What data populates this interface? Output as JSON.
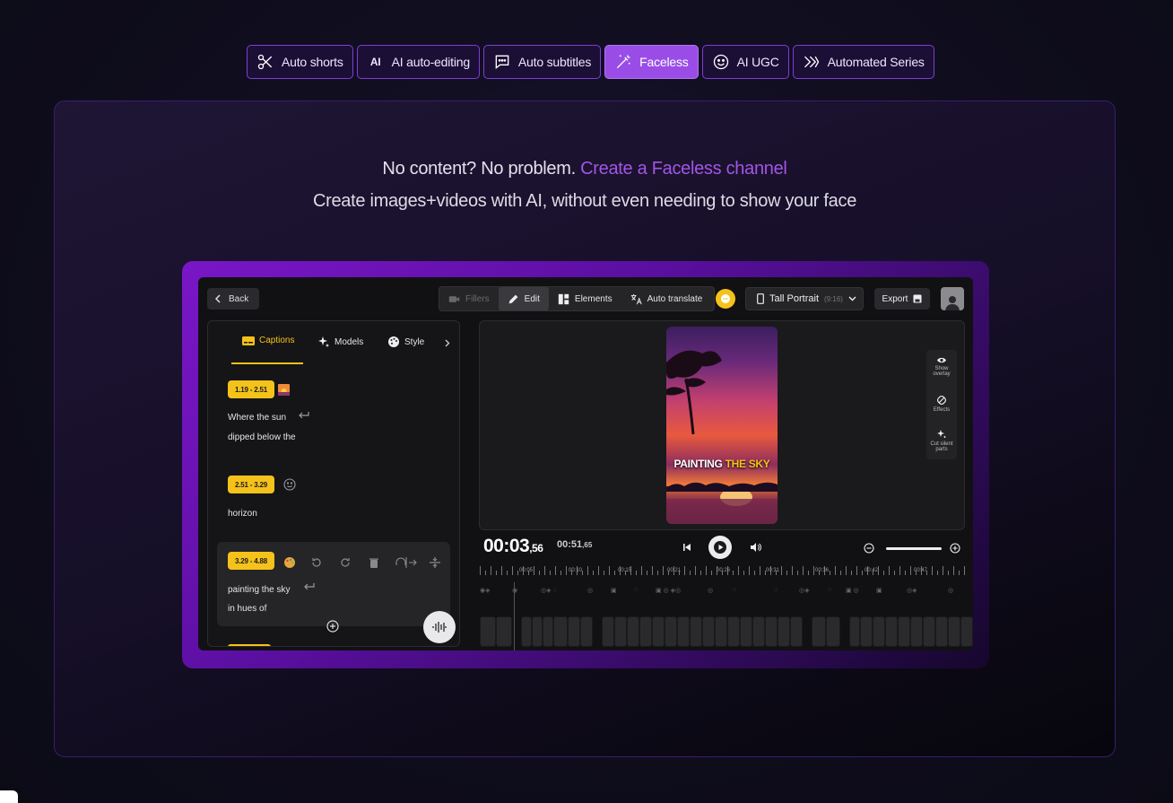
{
  "feature_tabs": [
    {
      "label": "Auto shorts",
      "icon": "scissors-icon",
      "active": false
    },
    {
      "label": "AI auto-editing",
      "icon": "ai-icon",
      "active": false
    },
    {
      "label": "Auto subtitles",
      "icon": "speech-bubble-icon",
      "active": false
    },
    {
      "label": "Faceless",
      "icon": "magic-wand-icon",
      "active": true
    },
    {
      "label": "AI UGC",
      "icon": "face-icon",
      "active": false
    },
    {
      "label": "Automated Series",
      "icon": "chevrons-icon",
      "active": false
    }
  ],
  "ai_glyph": "AI",
  "headline": {
    "lead": "No content? No problem.",
    "accent": "Create a Faceless channel"
  },
  "subline": "Create images+videos with AI, without even needing to show your face",
  "colors": {
    "accent": "#a455e6",
    "caption_yellow": "#f5c21b",
    "active_tab": "#9a4de6"
  },
  "editor": {
    "back_label": "Back",
    "modes": [
      {
        "label": "Fillers",
        "state": "disabled"
      },
      {
        "label": "Edit",
        "state": "active"
      },
      {
        "label": "Elements",
        "state": "normal"
      },
      {
        "label": "Auto translate",
        "state": "normal"
      }
    ],
    "format": {
      "label": "Tall Portrait",
      "ratio": "(9:16)"
    },
    "export_label": "Export",
    "caption_tabs": [
      "Captions",
      "Models",
      "Style"
    ],
    "captions": [
      {
        "time": "1.19 - 2.51",
        "lines": [
          "Where the sun",
          "dipped below the"
        ]
      },
      {
        "time": "2.51 - 3.29",
        "lines": [
          "horizon"
        ]
      },
      {
        "time": "3.29 - 4.88",
        "lines": [
          "painting the sky",
          "in hues of"
        ]
      }
    ],
    "preview": {
      "title_white": "PAINTING",
      "title_yellow": "THE SKY"
    },
    "side_tools": [
      {
        "label": "Show overlay",
        "icon": "eye-icon"
      },
      {
        "label": "Effects",
        "icon": "effects-icon"
      },
      {
        "label": "Cut silent parts",
        "icon": "sparkles-icon"
      }
    ],
    "timecode": {
      "main": "00:03",
      "frac": ",56"
    },
    "duration": {
      "main": "00:51",
      "frac": ",65"
    },
    "ruler_labels": [
      "00:05",
      "00:10",
      "00:15",
      "00:21",
      "00:26",
      "00:31",
      "00:36",
      "00:42",
      "00:47"
    ]
  }
}
